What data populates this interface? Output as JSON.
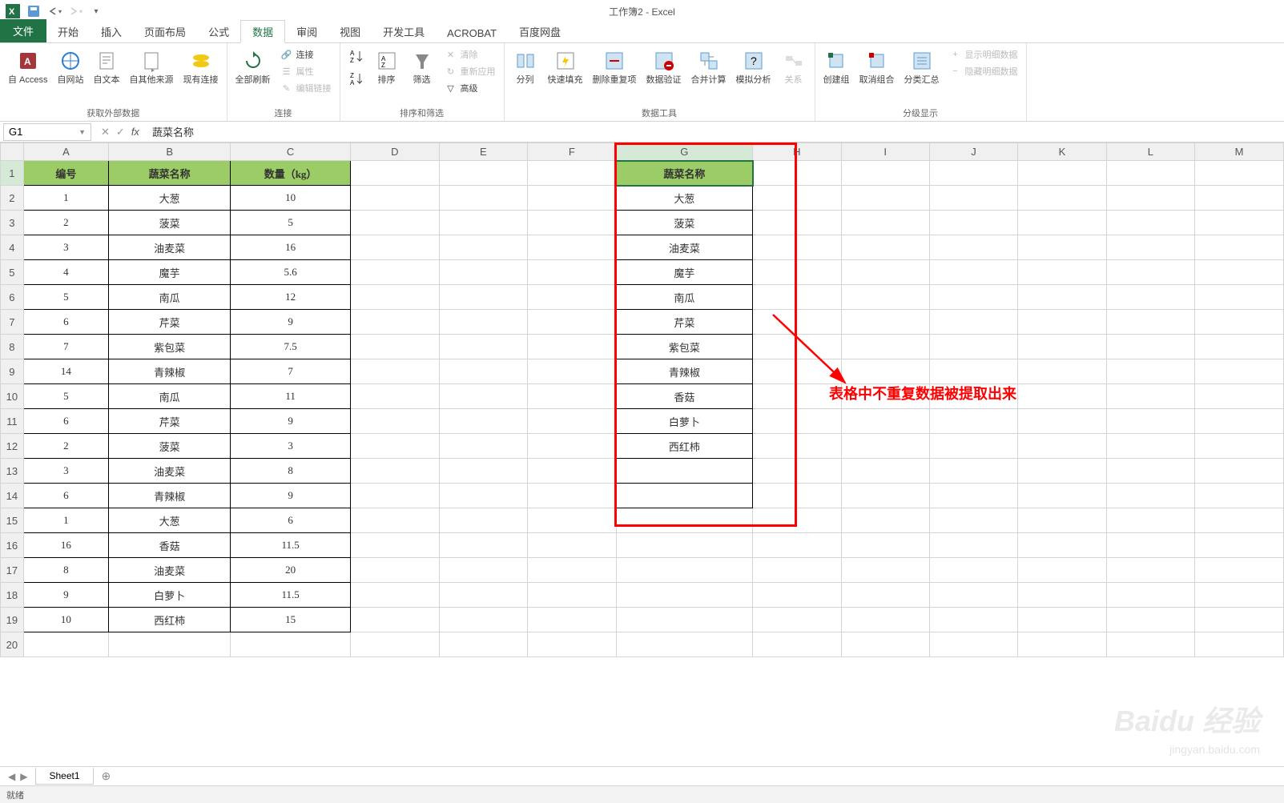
{
  "app": {
    "title": "工作簿2 - Excel"
  },
  "tabs": {
    "file": "文件",
    "home": "开始",
    "insert": "插入",
    "layout": "页面布局",
    "formulas": "公式",
    "data": "数据",
    "review": "审阅",
    "view": "视图",
    "dev": "开发工具",
    "acrobat": "ACROBAT",
    "baidu": "百度网盘"
  },
  "ribbon": {
    "g1": {
      "label": "获取外部数据",
      "access": "自 Access",
      "web": "自网站",
      "text": "自文本",
      "other": "自其他来源",
      "existing": "现有连接"
    },
    "g2": {
      "label": "连接",
      "refresh": "全部刷新",
      "conn": "连接",
      "prop": "属性",
      "edit": "编辑链接"
    },
    "g3": {
      "label": "排序和筛选",
      "sort": "排序",
      "filter": "筛选",
      "clear": "清除",
      "reapply": "重新应用",
      "adv": "高级"
    },
    "g4": {
      "label": "数据工具",
      "t2c": "分列",
      "flash": "快速填充",
      "dup": "删除重复项",
      "valid": "数据验证",
      "cons": "合并计算",
      "what": "模拟分析",
      "rel": "关系"
    },
    "g5": {
      "label": "分级显示",
      "grp": "创建组",
      "ungrp": "取消组合",
      "subtotal": "分类汇总",
      "show": "显示明细数据",
      "hide": "隐藏明细数据"
    }
  },
  "namebox": "G1",
  "formula": "蔬菜名称",
  "cols": [
    "A",
    "B",
    "C",
    "D",
    "E",
    "F",
    "G",
    "H",
    "I",
    "J",
    "K",
    "L",
    "M"
  ],
  "headers": {
    "a": "编号",
    "b": "蔬菜名称",
    "c": "数量（kg）"
  },
  "rows": [
    {
      "n": "1",
      "a": "1",
      "b": "大葱",
      "c": "10"
    },
    {
      "n": "2",
      "a": "2",
      "b": "菠菜",
      "c": "5"
    },
    {
      "n": "3",
      "a": "3",
      "b": "油麦菜",
      "c": "16"
    },
    {
      "n": "4",
      "a": "4",
      "b": "魔芋",
      "c": "5.6"
    },
    {
      "n": "5",
      "a": "5",
      "b": "南瓜",
      "c": "12"
    },
    {
      "n": "6",
      "a": "6",
      "b": "芹菜",
      "c": "9"
    },
    {
      "n": "7",
      "a": "7",
      "b": "紫包菜",
      "c": "7.5"
    },
    {
      "n": "8",
      "a": "14",
      "b": "青辣椒",
      "c": "7"
    },
    {
      "n": "9",
      "a": "5",
      "b": "南瓜",
      "c": "11"
    },
    {
      "n": "10",
      "a": "6",
      "b": "芹菜",
      "c": "9"
    },
    {
      "n": "11",
      "a": "2",
      "b": "菠菜",
      "c": "3"
    },
    {
      "n": "12",
      "a": "3",
      "b": "油麦菜",
      "c": "8"
    },
    {
      "n": "13",
      "a": "6",
      "b": "青辣椒",
      "c": "9"
    },
    {
      "n": "14",
      "a": "1",
      "b": "大葱",
      "c": "6"
    },
    {
      "n": "15",
      "a": "16",
      "b": "香菇",
      "c": "11.5"
    },
    {
      "n": "16",
      "a": "8",
      "b": "油麦菜",
      "c": "20"
    },
    {
      "n": "17",
      "a": "9",
      "b": "白萝卜",
      "c": "11.5"
    },
    {
      "n": "18",
      "a": "10",
      "b": "西红柿",
      "c": "15"
    }
  ],
  "colG": {
    "header": "蔬菜名称",
    "items": [
      "大葱",
      "菠菜",
      "油麦菜",
      "魔芋",
      "南瓜",
      "芹菜",
      "紫包菜",
      "青辣椒",
      "香菇",
      "白萝卜",
      "西红柿",
      "",
      ""
    ]
  },
  "annotation": "表格中不重复数据被提取出来",
  "sheet_tab": "Sheet1",
  "status": "就绪",
  "watermark": "Baidu 经验",
  "watermark_url": "jingyan.baidu.com"
}
